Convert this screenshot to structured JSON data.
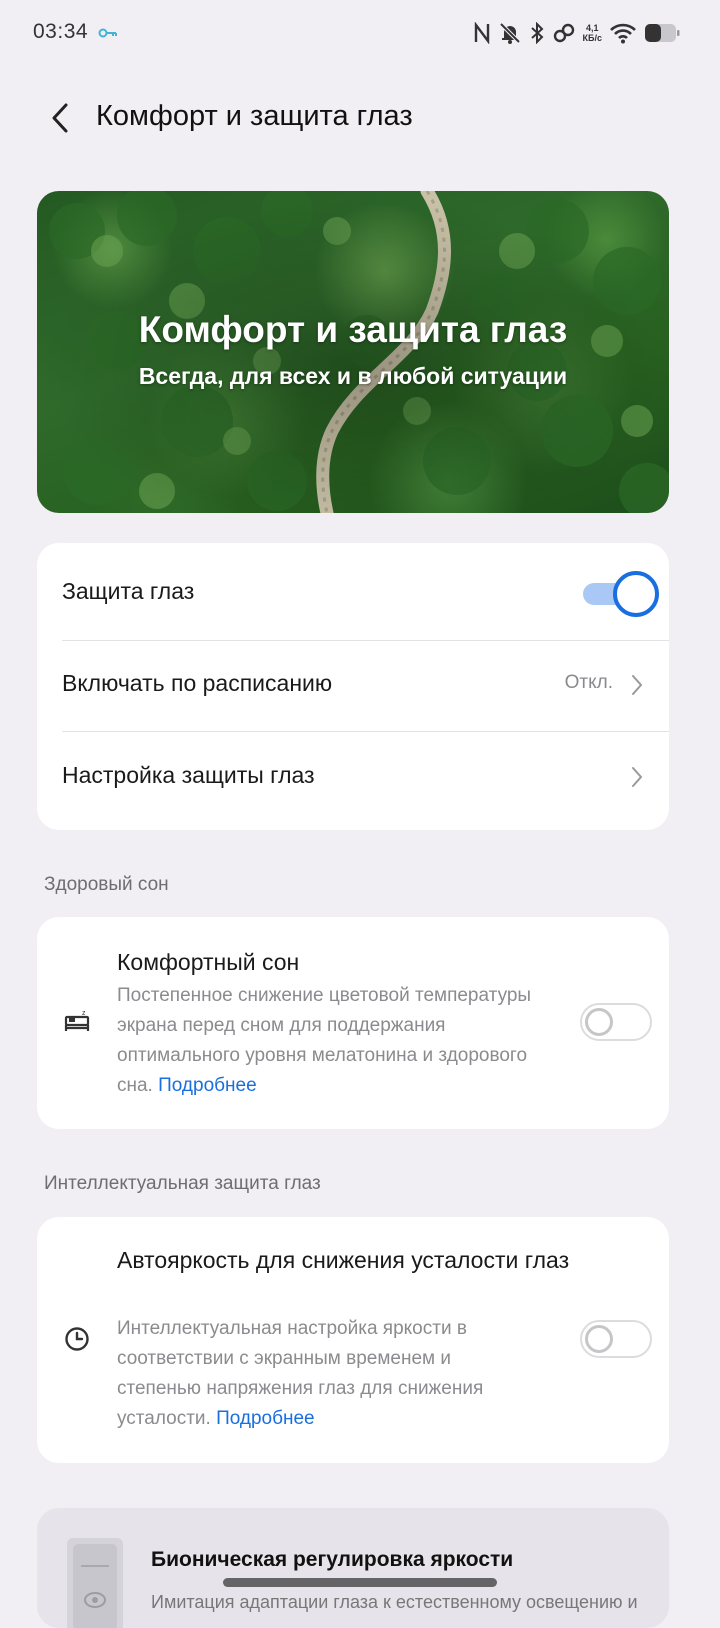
{
  "status_bar": {
    "time": "03:34",
    "net_speed_value": "4,1",
    "net_speed_unit": "КБ/с",
    "icons": [
      "vpn-key-icon",
      "nfc-icon",
      "silent-bell-icon",
      "bluetooth-icon",
      "link-icon",
      "wifi-icon",
      "battery-icon"
    ]
  },
  "header": {
    "title": "Комфорт и защита глаз"
  },
  "banner": {
    "title": "Комфорт и защита глаз",
    "subtitle": "Всегда, для всех и в любой ситуации"
  },
  "main_settings": {
    "eye_protection": {
      "label": "Защита глаз",
      "enabled": true
    },
    "schedule": {
      "label": "Включать по расписанию",
      "value": "Откл."
    },
    "eye_protection_settings": {
      "label": "Настройка защиты глаз"
    }
  },
  "healthy_sleep": {
    "heading": "Здоровый сон",
    "comfort_sleep": {
      "title": "Комфортный сон",
      "description": "Постепенное снижение цветовой температуры экрана перед сном для поддержания оптимального уровня мелатонина и здорового сна.",
      "link": "Подробнее",
      "enabled": false
    }
  },
  "smart_protection": {
    "heading": "Интеллектуальная защита глаз",
    "auto_brightness": {
      "title": "Автояркость для снижения усталости глаз",
      "description": "Интеллектуальная настройка яркости в соответствии с экранным временем и степенью напряжения глаз для снижения усталости.",
      "link": "Подробнее",
      "enabled": false
    }
  },
  "bionic": {
    "title": "Бионическая регулировка яркости",
    "description": "Имитация адаптации глаза к естественному освещению и"
  },
  "colors": {
    "accent": "#1a6fe0",
    "background": "#f1eff4",
    "card": "#ffffff"
  }
}
